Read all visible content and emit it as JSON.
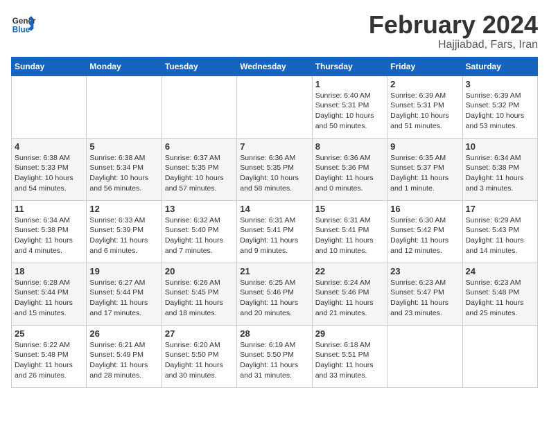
{
  "header": {
    "logo_line1": "General",
    "logo_line2": "Blue",
    "month": "February 2024",
    "location": "Hajjiabad, Fars, Iran"
  },
  "weekdays": [
    "Sunday",
    "Monday",
    "Tuesday",
    "Wednesday",
    "Thursday",
    "Friday",
    "Saturday"
  ],
  "weeks": [
    [
      {
        "day": "",
        "info": ""
      },
      {
        "day": "",
        "info": ""
      },
      {
        "day": "",
        "info": ""
      },
      {
        "day": "",
        "info": ""
      },
      {
        "day": "1",
        "info": "Sunrise: 6:40 AM\nSunset: 5:31 PM\nDaylight: 10 hours\nand 50 minutes."
      },
      {
        "day": "2",
        "info": "Sunrise: 6:39 AM\nSunset: 5:31 PM\nDaylight: 10 hours\nand 51 minutes."
      },
      {
        "day": "3",
        "info": "Sunrise: 6:39 AM\nSunset: 5:32 PM\nDaylight: 10 hours\nand 53 minutes."
      }
    ],
    [
      {
        "day": "4",
        "info": "Sunrise: 6:38 AM\nSunset: 5:33 PM\nDaylight: 10 hours\nand 54 minutes."
      },
      {
        "day": "5",
        "info": "Sunrise: 6:38 AM\nSunset: 5:34 PM\nDaylight: 10 hours\nand 56 minutes."
      },
      {
        "day": "6",
        "info": "Sunrise: 6:37 AM\nSunset: 5:35 PM\nDaylight: 10 hours\nand 57 minutes."
      },
      {
        "day": "7",
        "info": "Sunrise: 6:36 AM\nSunset: 5:35 PM\nDaylight: 10 hours\nand 58 minutes."
      },
      {
        "day": "8",
        "info": "Sunrise: 6:36 AM\nSunset: 5:36 PM\nDaylight: 11 hours\nand 0 minutes."
      },
      {
        "day": "9",
        "info": "Sunrise: 6:35 AM\nSunset: 5:37 PM\nDaylight: 11 hours\nand 1 minute."
      },
      {
        "day": "10",
        "info": "Sunrise: 6:34 AM\nSunset: 5:38 PM\nDaylight: 11 hours\nand 3 minutes."
      }
    ],
    [
      {
        "day": "11",
        "info": "Sunrise: 6:34 AM\nSunset: 5:38 PM\nDaylight: 11 hours\nand 4 minutes."
      },
      {
        "day": "12",
        "info": "Sunrise: 6:33 AM\nSunset: 5:39 PM\nDaylight: 11 hours\nand 6 minutes."
      },
      {
        "day": "13",
        "info": "Sunrise: 6:32 AM\nSunset: 5:40 PM\nDaylight: 11 hours\nand 7 minutes."
      },
      {
        "day": "14",
        "info": "Sunrise: 6:31 AM\nSunset: 5:41 PM\nDaylight: 11 hours\nand 9 minutes."
      },
      {
        "day": "15",
        "info": "Sunrise: 6:31 AM\nSunset: 5:41 PM\nDaylight: 11 hours\nand 10 minutes."
      },
      {
        "day": "16",
        "info": "Sunrise: 6:30 AM\nSunset: 5:42 PM\nDaylight: 11 hours\nand 12 minutes."
      },
      {
        "day": "17",
        "info": "Sunrise: 6:29 AM\nSunset: 5:43 PM\nDaylight: 11 hours\nand 14 minutes."
      }
    ],
    [
      {
        "day": "18",
        "info": "Sunrise: 6:28 AM\nSunset: 5:44 PM\nDaylight: 11 hours\nand 15 minutes."
      },
      {
        "day": "19",
        "info": "Sunrise: 6:27 AM\nSunset: 5:44 PM\nDaylight: 11 hours\nand 17 minutes."
      },
      {
        "day": "20",
        "info": "Sunrise: 6:26 AM\nSunset: 5:45 PM\nDaylight: 11 hours\nand 18 minutes."
      },
      {
        "day": "21",
        "info": "Sunrise: 6:25 AM\nSunset: 5:46 PM\nDaylight: 11 hours\nand 20 minutes."
      },
      {
        "day": "22",
        "info": "Sunrise: 6:24 AM\nSunset: 5:46 PM\nDaylight: 11 hours\nand 21 minutes."
      },
      {
        "day": "23",
        "info": "Sunrise: 6:23 AM\nSunset: 5:47 PM\nDaylight: 11 hours\nand 23 minutes."
      },
      {
        "day": "24",
        "info": "Sunrise: 6:23 AM\nSunset: 5:48 PM\nDaylight: 11 hours\nand 25 minutes."
      }
    ],
    [
      {
        "day": "25",
        "info": "Sunrise: 6:22 AM\nSunset: 5:48 PM\nDaylight: 11 hours\nand 26 minutes."
      },
      {
        "day": "26",
        "info": "Sunrise: 6:21 AM\nSunset: 5:49 PM\nDaylight: 11 hours\nand 28 minutes."
      },
      {
        "day": "27",
        "info": "Sunrise: 6:20 AM\nSunset: 5:50 PM\nDaylight: 11 hours\nand 30 minutes."
      },
      {
        "day": "28",
        "info": "Sunrise: 6:19 AM\nSunset: 5:50 PM\nDaylight: 11 hours\nand 31 minutes."
      },
      {
        "day": "29",
        "info": "Sunrise: 6:18 AM\nSunset: 5:51 PM\nDaylight: 11 hours\nand 33 minutes."
      },
      {
        "day": "",
        "info": ""
      },
      {
        "day": "",
        "info": ""
      }
    ]
  ]
}
